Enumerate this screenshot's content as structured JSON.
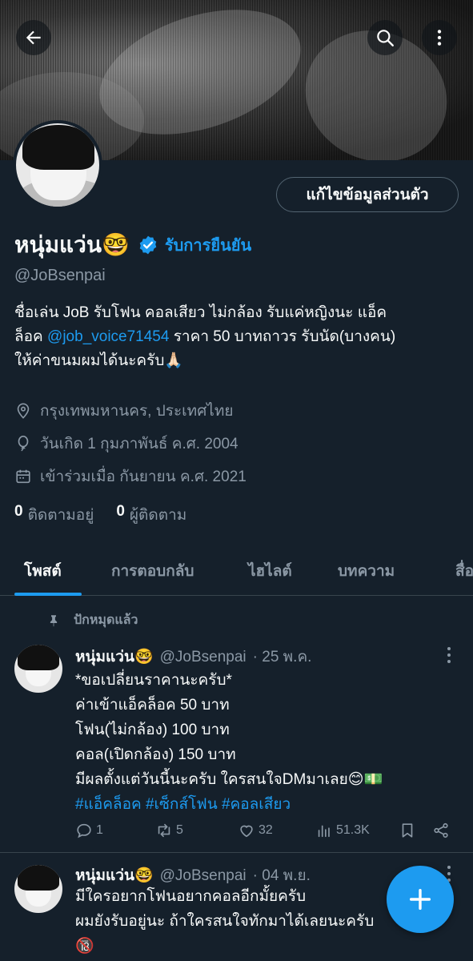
{
  "profile": {
    "name": "หนุ่มแว่น🤓",
    "verify_label": "รับการยืนยัน",
    "handle": "@JoBsenpai",
    "edit_button": "แก้ไขข้อมูลส่วนตัว",
    "bio_line1": "ชื่อเล่น JoB รับโฟน คอลเสียว ไม่กล้อง รับแค่หญิงนะ แอ็ค",
    "bio_line2_pre": "ล็อค ",
    "bio_mention": "@job_voice71454",
    "bio_line2_post": " ราคา 50 บาทถาวร รับนัด(บางคน)",
    "bio_line3": "ให้ค่าขนมผมได้นะครับ🙏🏻",
    "location": "กรุงเทพมหานคร, ประเทศไทย",
    "birthday": "วันเกิด 1 กุมภาพันธ์ ค.ศ. 2004",
    "joined": "เข้าร่วมเมื่อ กันยายน ค.ศ. 2021",
    "following_count": "0",
    "following_label": "ติดตามอยู่",
    "followers_count": "0",
    "followers_label": "ผู้ติดตาม"
  },
  "tabs": [
    "โพสต์",
    "การตอบกลับ",
    "ไฮไลต์",
    "บทความ",
    "สื่อ"
  ],
  "pinned_label": "ปักหมุดแล้ว",
  "posts": [
    {
      "name": "หนุ่มแว่น🤓",
      "handle": "@JoBsenpai",
      "time": "· 25 พ.ค.",
      "lines": [
        "*ขอเปลี่ยนราคานะครับ*",
        "ค่าเข้าแอ็คล็อค 50 บาท",
        "โฟน(ไม่กล้อง) 100 บาท",
        "คอล(เปิดกล้อง) 150 บาท",
        "มีผลตั้งแต่วันนี้นะครับ ใครสนใจDMมาเลย😊💵"
      ],
      "hashtags": "#แอ็คล็อค #เซ็กส์โฟน #คอลเสียว",
      "replies": "1",
      "reposts": "5",
      "likes": "32",
      "views": "51.3K"
    },
    {
      "name": "หนุ่มแว่น🤓",
      "handle": "@JoBsenpai",
      "time": "· 04 พ.ย.",
      "lines": [
        "มีใครอยากโฟนอยากคอลอีกมั้ยครับ",
        "ผมยังรับอยู่นะ ถ้าใครสนใจทักมาได้เลยนะครับ",
        "🔞"
      ]
    }
  ],
  "colors": {
    "background": "#15202b",
    "accent": "#1d9bf0",
    "muted": "#8b98a5"
  }
}
